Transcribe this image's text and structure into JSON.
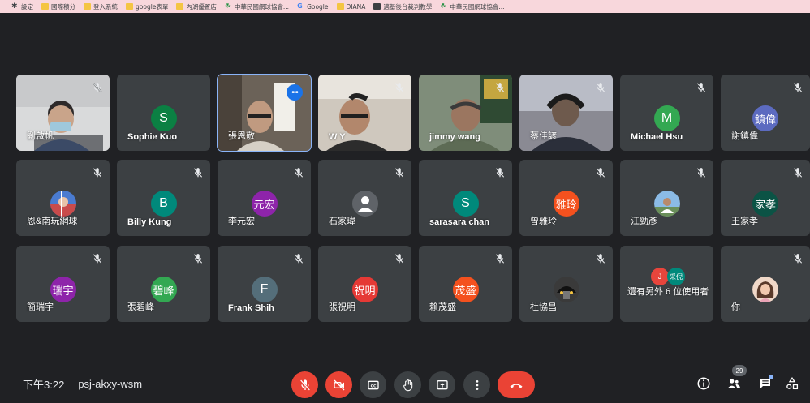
{
  "bookmarks": [
    {
      "label": "設定",
      "icon": "gear-icon"
    },
    {
      "label": "國際積分",
      "icon": "folder-icon"
    },
    {
      "label": "登入系統",
      "icon": "folder-icon"
    },
    {
      "label": "google表單",
      "icon": "folder-icon"
    },
    {
      "label": "內湖優置店",
      "icon": "folder-icon"
    },
    {
      "label": "中華民國網球協會...",
      "icon": "leaf-icon"
    },
    {
      "label": "Google",
      "icon": "google-icon"
    },
    {
      "label": "DIANA",
      "icon": "folder-icon"
    },
    {
      "label": "邁基後台裁判教學",
      "icon": "globe-icon"
    },
    {
      "label": "中華民國網球協會...",
      "icon": "leaf-icon"
    }
  ],
  "participants": [
    {
      "name": "劉啟帆",
      "video": true
    },
    {
      "name": "Sophie Kuo",
      "initial": "S",
      "color": "#0b8043"
    },
    {
      "name": "張恩敬",
      "video": true
    },
    {
      "name": "W Y",
      "video": true
    },
    {
      "name": "jimmy wang",
      "video": true
    },
    {
      "name": "蔡佳諺",
      "video": true
    },
    {
      "name": "Michael Hsu",
      "initial": "M",
      "color": "#33a852"
    },
    {
      "name": "謝鎮偉",
      "initial": "鎮偉",
      "color": "#5c6bc0"
    },
    {
      "name": "恩&南玩網球",
      "photo": true
    },
    {
      "name": "Billy Kung",
      "initial": "B",
      "color": "#00897b"
    },
    {
      "name": "李元宏",
      "initial": "元宏",
      "color": "#8e24aa"
    },
    {
      "name": "石家瑋",
      "photo": true
    },
    {
      "name": "sarasara chan",
      "initial": "S",
      "color": "#00897b"
    },
    {
      "name": "曾雅玲",
      "initial": "雅玲",
      "color": "#f4511e"
    },
    {
      "name": "江勁彥",
      "photo": true
    },
    {
      "name": "王家孝",
      "initial": "家孝",
      "color": "#0b5345"
    },
    {
      "name": "簡瑞宇",
      "initial": "瑞宇",
      "color": "#8e24aa"
    },
    {
      "name": "張碧峰",
      "initial": "碧峰",
      "color": "#33a852"
    },
    {
      "name": "Frank Shih",
      "initial": "F",
      "color": "#546e7a"
    },
    {
      "name": "張祝明",
      "initial": "祝明",
      "color": "#e53935"
    },
    {
      "name": "賴茂盛",
      "initial": "茂盛",
      "color": "#f4511e"
    },
    {
      "name": "杜協昌",
      "photo": true
    },
    {
      "name": "還有另外 6 位使用者",
      "mini": [
        {
          "text": "J",
          "color": "#e8453c"
        },
        {
          "text": "采倪",
          "color": "#00897b"
        }
      ]
    },
    {
      "name": "你",
      "photo": true
    }
  ],
  "bottom_bar": {
    "time": "下午3:22",
    "meeting_code": "psj-akxy-wsm",
    "participant_count": "29"
  }
}
